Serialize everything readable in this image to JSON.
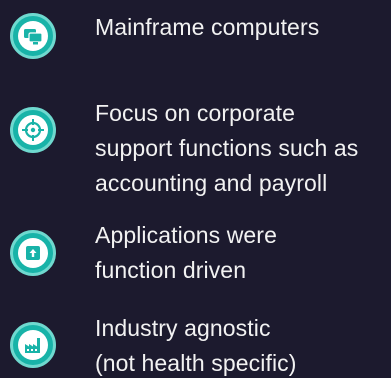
{
  "items": [
    {
      "icon": "monitor-icon",
      "lines": [
        "Mainframe computers"
      ]
    },
    {
      "icon": "crosshair-icon",
      "lines": [
        "Focus on corporate",
        "support functions such as",
        "accounting and payroll"
      ]
    },
    {
      "icon": "upload-box-icon",
      "lines": [
        "Applications were",
        "function driven"
      ]
    },
    {
      "icon": "factory-icon",
      "lines": [
        "Industry agnostic",
        "(not health specific)"
      ]
    }
  ],
  "colors": {
    "background": "#1c1a2e",
    "badge": "#18b3a8",
    "badge_ring": "#6fd9cf",
    "text": "#f2f2f2"
  }
}
